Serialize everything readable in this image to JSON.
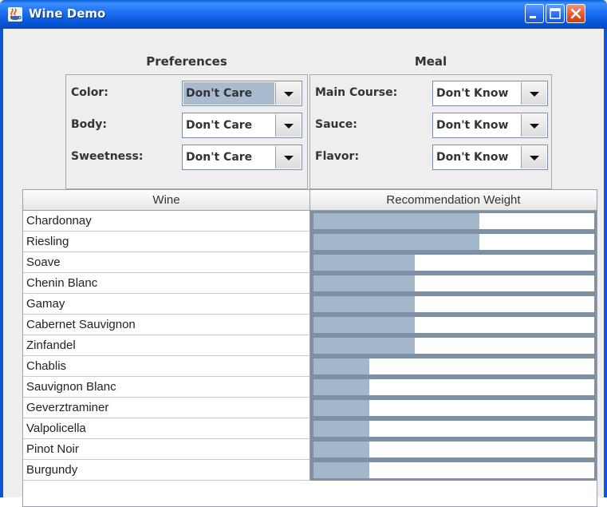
{
  "window": {
    "title": "Wine Demo"
  },
  "preferences": {
    "title": "Preferences",
    "fields": [
      {
        "label": "Color:",
        "value": "Don't Care"
      },
      {
        "label": "Body:",
        "value": "Don't Care"
      },
      {
        "label": "Sweetness:",
        "value": "Don't Care"
      }
    ]
  },
  "meal": {
    "title": "Meal",
    "fields": [
      {
        "label": "Main Course:",
        "value": "Don't Know"
      },
      {
        "label": "Sauce:",
        "value": "Don't Know"
      },
      {
        "label": "Flavor:",
        "value": "Don't Know"
      }
    ]
  },
  "table": {
    "columns": [
      "Wine",
      "Recommendation Weight"
    ],
    "rows": [
      {
        "wine": "Chardonnay",
        "weight": 0.59
      },
      {
        "wine": "Riesling",
        "weight": 0.59
      },
      {
        "wine": "Soave",
        "weight": 0.36
      },
      {
        "wine": "Chenin Blanc",
        "weight": 0.36
      },
      {
        "wine": "Gamay",
        "weight": 0.36
      },
      {
        "wine": "Cabernet Sauvignon",
        "weight": 0.36
      },
      {
        "wine": "Zinfandel",
        "weight": 0.36
      },
      {
        "wine": "Chablis",
        "weight": 0.2
      },
      {
        "wine": "Sauvignon Blanc",
        "weight": 0.2
      },
      {
        "wine": "Geverztraminer",
        "weight": 0.2
      },
      {
        "wine": "Valpolicella",
        "weight": 0.2
      },
      {
        "wine": "Pinot Noir",
        "weight": 0.2
      },
      {
        "wine": "Burgundy",
        "weight": 0.2
      }
    ]
  },
  "colors": {
    "titlebar": "#1b6df2",
    "bar_fill": "#a3b8ca",
    "combo_selected": "#a8bbcf"
  },
  "icons": {
    "app": "java-cup-icon",
    "minimize": "minimize-icon",
    "maximize": "maximize-icon",
    "close": "close-icon",
    "combo_arrow": "chevron-down-icon"
  }
}
